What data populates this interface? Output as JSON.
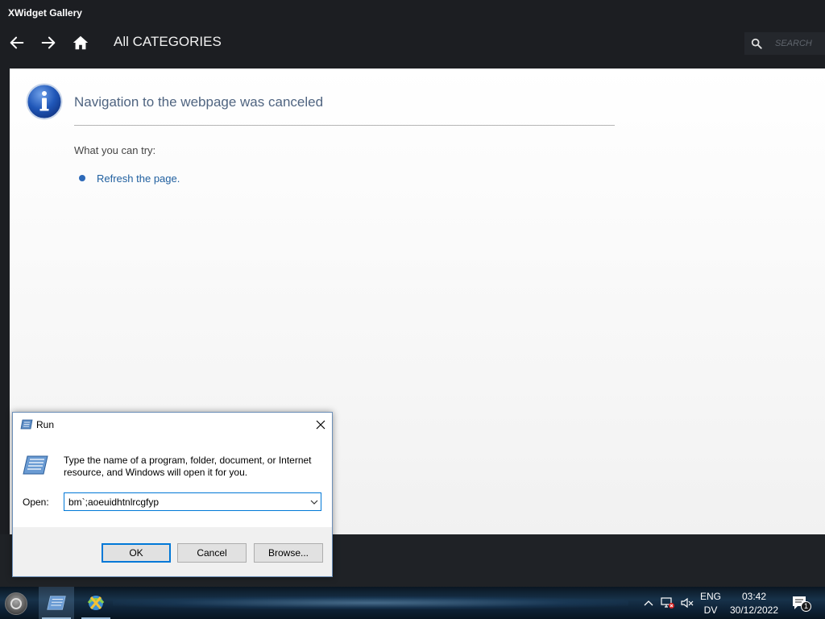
{
  "app": {
    "title": "XWidget Gallery",
    "nav_title": "All CATEGORIES",
    "search_placeholder": "SEARCH"
  },
  "error_page": {
    "title": "Navigation to the webpage was canceled",
    "try_label": "What you can try:",
    "refresh_link": "Refresh the page."
  },
  "run_dialog": {
    "title": "Run",
    "description": "Type the name of a program, folder, document, or Internet resource, and Windows will open it for you.",
    "open_label": "Open:",
    "open_value": "bm`;aoeuidhtnlrcgfyp",
    "ok_label": "OK",
    "cancel_label": "Cancel",
    "browse_label": "Browse..."
  },
  "taskbar": {
    "language_line1": "ENG",
    "language_line2": "DV",
    "time": "03:42",
    "date": "30/12/2022",
    "notification_count": "1",
    "apps": [
      "run-app-icon",
      "xwidget-app-icon"
    ],
    "tray_icons": [
      "chevron-up-icon",
      "network-icon",
      "volume-muted-icon"
    ]
  },
  "colors": {
    "accent": "#0078d7",
    "link": "#1f5f9f",
    "error_title": "#4f6480",
    "window_bg": "#1c1e22"
  }
}
